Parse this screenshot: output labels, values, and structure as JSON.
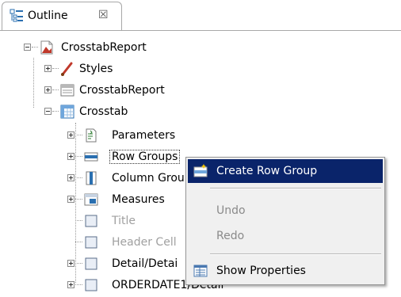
{
  "view": {
    "tab": {
      "label": "Outline",
      "close_glyph": "☒",
      "icon": "outline-icon"
    }
  },
  "tree": {
    "root": {
      "label": "CrosstabReport",
      "icon": "report-icon",
      "expanded": true
    },
    "root_children": [
      {
        "label": "Styles",
        "icon": "styles-icon",
        "expanded": false
      },
      {
        "label": "CrosstabReport",
        "icon": "report-body-icon",
        "expanded": false
      },
      {
        "label": "Crosstab",
        "icon": "crosstab-icon",
        "expanded": true
      }
    ],
    "crosstab_children": [
      {
        "label": "Parameters",
        "icon": "parameters-icon",
        "expanded": false,
        "enabled": true
      },
      {
        "label": "Row Groups",
        "icon": "row-groups-icon",
        "expanded": false,
        "enabled": true,
        "selected": true
      },
      {
        "label": "Column Grou",
        "icon": "column-groups-icon",
        "expanded": false,
        "enabled": true
      },
      {
        "label": "Measures",
        "icon": "measures-icon",
        "expanded": false,
        "enabled": true
      },
      {
        "label": "Title",
        "icon": "cell-icon",
        "enabled": false
      },
      {
        "label": "Header Cell",
        "icon": "cell-icon",
        "enabled": false
      },
      {
        "label": "Detail/Detai",
        "icon": "cell-icon",
        "expanded": false,
        "enabled": true
      },
      {
        "label": "ORDERDATE1/Detail",
        "icon": "cell-icon",
        "expanded": false,
        "enabled": true
      }
    ]
  },
  "context_menu": {
    "items": [
      {
        "label": "Create Row Group",
        "icon": "create-row-group-icon",
        "enabled": true,
        "highlighted": true
      },
      {
        "label": "Undo",
        "enabled": false
      },
      {
        "label": "Redo",
        "enabled": false
      },
      {
        "label": "Show Properties",
        "icon": "properties-icon",
        "enabled": true
      }
    ]
  },
  "colors": {
    "menu_highlight": "#0a246a",
    "menu_background": "#f0f0f0",
    "disabled_text": "#a0a0a0"
  }
}
